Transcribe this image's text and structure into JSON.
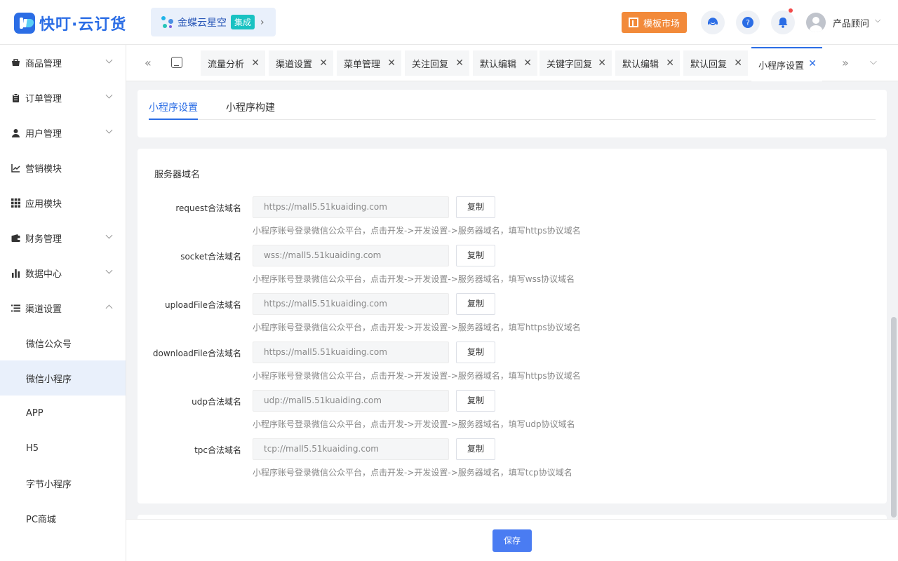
{
  "header": {
    "logo_text": "快叮·云订货",
    "brand": {
      "name": "金蝶云星空",
      "tag": "集成"
    },
    "market_button": "模板市场",
    "icons": [
      "service-icon",
      "help-icon",
      "bell-icon"
    ],
    "user_name": "产品顾问"
  },
  "sidebar": {
    "items": [
      {
        "label": "商品管理",
        "icon": "cart-icon",
        "expandable": true
      },
      {
        "label": "订单管理",
        "icon": "clipboard-icon",
        "expandable": true
      },
      {
        "label": "用户管理",
        "icon": "user-icon",
        "expandable": true
      },
      {
        "label": "营销模块",
        "icon": "trend-icon",
        "expandable": false
      },
      {
        "label": "应用模块",
        "icon": "grid-icon",
        "expandable": false
      },
      {
        "label": "财务管理",
        "icon": "wallet-icon",
        "expandable": true
      },
      {
        "label": "数据中心",
        "icon": "bar-chart-icon",
        "expandable": true
      },
      {
        "label": "渠道设置",
        "icon": "list-icon",
        "expandable": true,
        "expanded": true
      }
    ],
    "sub_items": [
      "微信公众号",
      "微信小程序",
      "APP",
      "H5",
      "字节小程序",
      "PC商城"
    ],
    "active_sub": "微信小程序"
  },
  "tabs": [
    {
      "label": "流量分析"
    },
    {
      "label": "渠道设置"
    },
    {
      "label": "菜单管理"
    },
    {
      "label": "关注回复"
    },
    {
      "label": "默认编辑"
    },
    {
      "label": "关键字回复"
    },
    {
      "label": "默认编辑"
    },
    {
      "label": "默认回复"
    },
    {
      "label": "小程序设置",
      "active": true
    }
  ],
  "subtabs": [
    "小程序设置",
    "小程序构建"
  ],
  "section_title": "服务器域名",
  "copy_label": "复制",
  "fields": [
    {
      "label": "request合法域名",
      "value": "https://mall5.51kuaiding.com",
      "hint": "小程序账号登录微信公众平台，点击开发->开发设置->服务器域名，填写https协议域名"
    },
    {
      "label": "socket合法域名",
      "value": "wss://mall5.51kuaiding.com",
      "hint": "小程序账号登录微信公众平台，点击开发->开发设置->服务器域名，填写wss协议域名"
    },
    {
      "label": "uploadFile合法域名",
      "value": "https://mall5.51kuaiding.com",
      "hint": "小程序账号登录微信公众平台，点击开发->开发设置->服务器域名，填写https协议域名"
    },
    {
      "label": "downloadFile合法域名",
      "value": "https://mall5.51kuaiding.com",
      "hint": "小程序账号登录微信公众平台，点击开发->开发设置->服务器域名，填写https协议域名"
    },
    {
      "label": "udp合法域名",
      "value": "udp://mall5.51kuaiding.com",
      "hint": "小程序账号登录微信公众平台，点击开发->开发设置->服务器域名，填写udp协议域名"
    },
    {
      "label": "tpc合法域名",
      "value": "tcp://mall5.51kuaiding.com",
      "hint": "小程序账号登录微信公众平台，点击开发->开发设置->服务器域名，填写tcp协议域名"
    }
  ],
  "save_label": "保存",
  "colors": {
    "primary": "#2b6de5",
    "market": "#f28a3a",
    "tag": "#19c2c2",
    "save": "#4a7cf2"
  }
}
